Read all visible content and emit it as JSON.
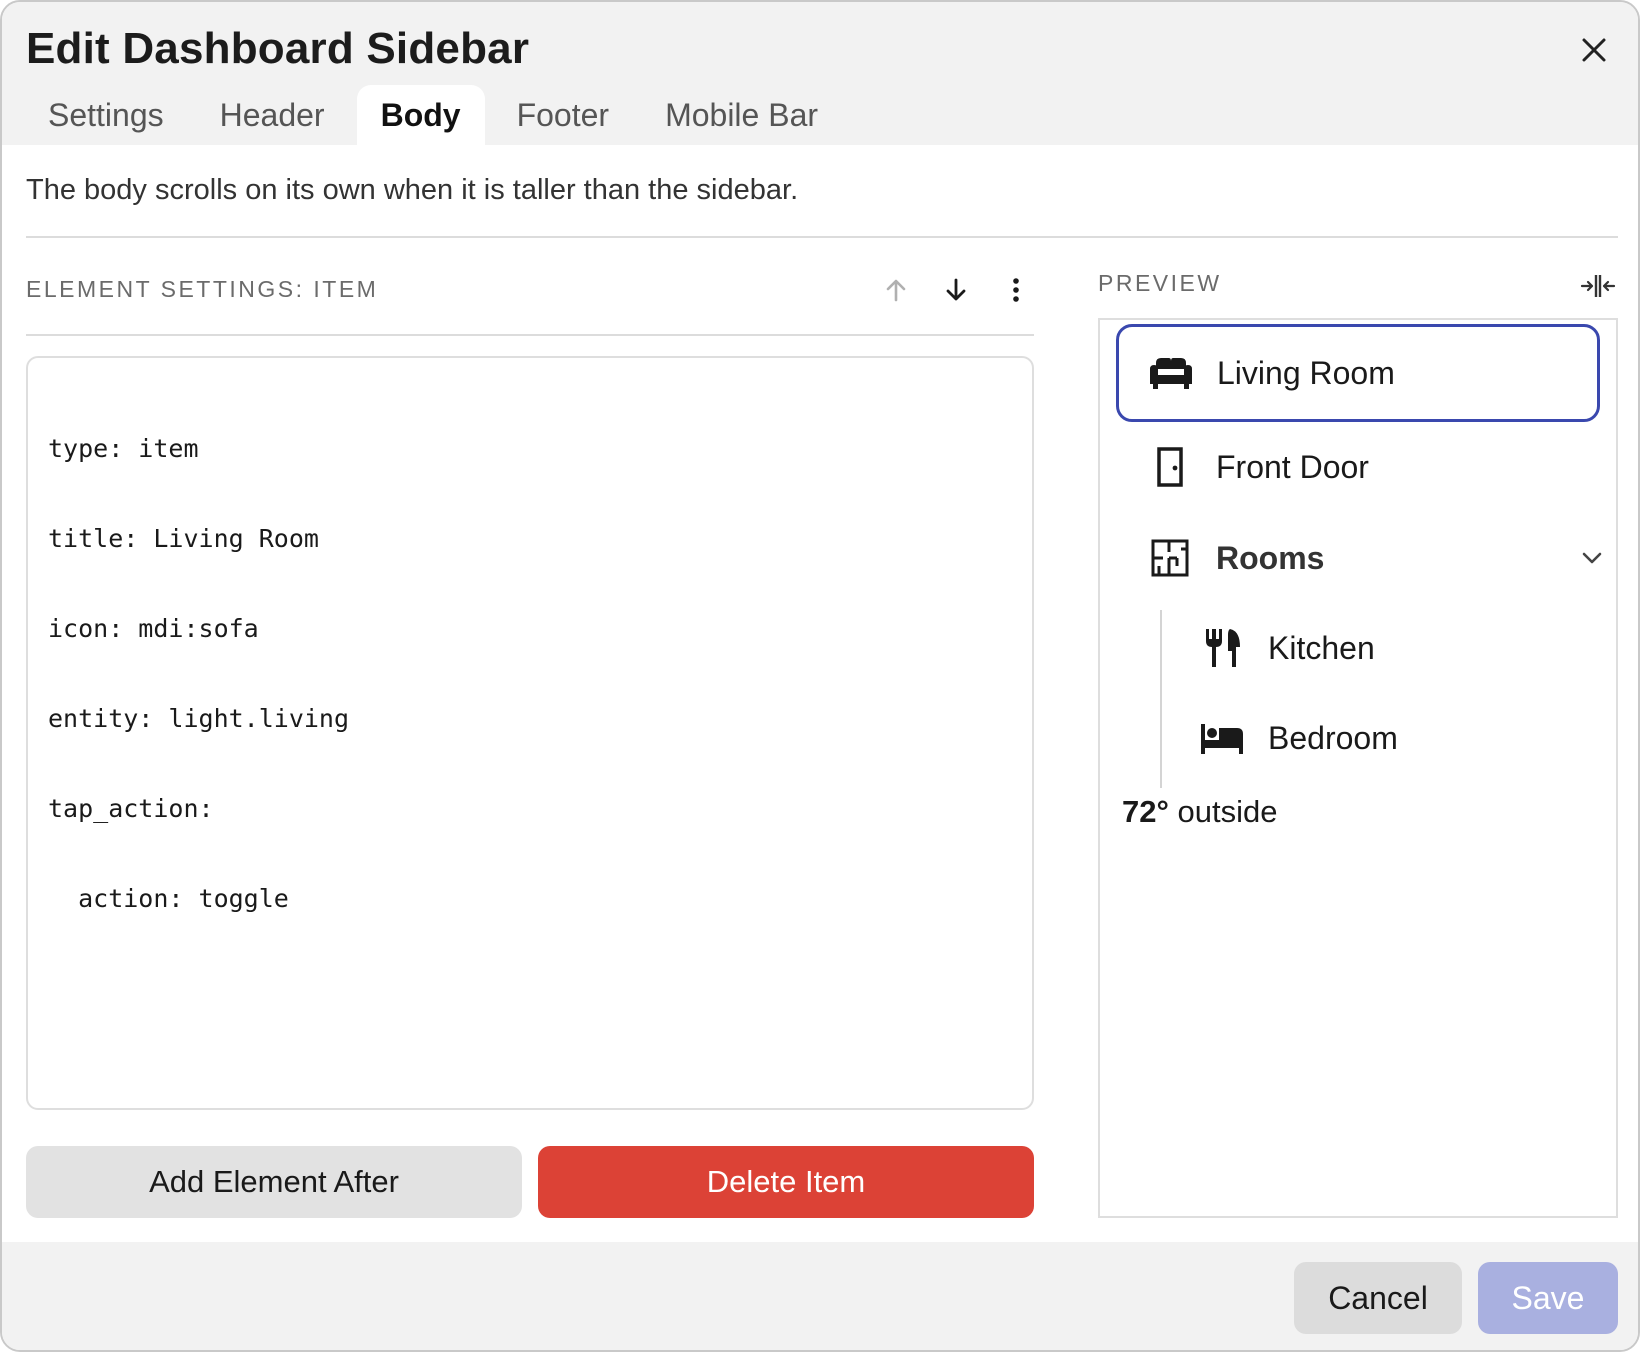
{
  "dialog": {
    "title": "Edit Dashboard Sidebar",
    "close_icon": "close-icon"
  },
  "tabs": [
    {
      "label": "Settings",
      "active": false
    },
    {
      "label": "Header",
      "active": false
    },
    {
      "label": "Body",
      "active": true
    },
    {
      "label": "Footer",
      "active": false
    },
    {
      "label": "Mobile Bar",
      "active": false
    }
  ],
  "description": "The body scrolls on its own when it is taller than the sidebar.",
  "element_settings": {
    "label": "ELEMENT SETTINGS: ITEM",
    "toolbar_icons": [
      "arrow-up-icon",
      "arrow-down-icon",
      "more-vertical-icon"
    ],
    "code_lines": [
      "type: item",
      "title: Living Room",
      "icon: mdi:sofa",
      "entity: light.living",
      "tap_action:",
      "  action: toggle"
    ],
    "add_button": "Add Element After",
    "delete_button": "Delete Item"
  },
  "preview": {
    "label": "PREVIEW",
    "toggle_icon": "split-width-icon",
    "items": [
      {
        "label": "Living Room",
        "icon": "sofa-icon",
        "selected": true
      },
      {
        "label": "Front Door",
        "icon": "door-icon",
        "selected": false
      }
    ],
    "group": {
      "label": "Rooms",
      "icon": "floor-plan-icon",
      "expanded": true,
      "children": [
        {
          "label": "Kitchen",
          "icon": "silverware-icon"
        },
        {
          "label": "Bedroom",
          "icon": "bed-icon"
        }
      ]
    },
    "temperature_value": "72°",
    "temperature_suffix": " outside"
  },
  "footer": {
    "cancel": "Cancel",
    "save": "Save"
  },
  "colors": {
    "accent": "#3a48ae",
    "danger": "#dc4236",
    "save_disabled": "#a9b0e0"
  }
}
